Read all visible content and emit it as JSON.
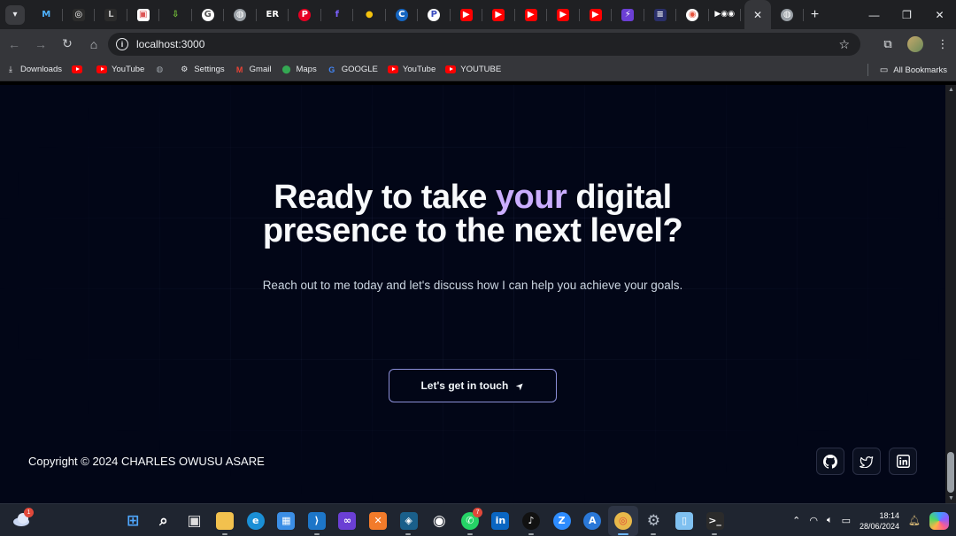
{
  "browser": {
    "tabs": [
      {
        "icon": "v",
        "color": "#3a3b3f",
        "name": "tab-list-icon"
      },
      {
        "icon": "M",
        "color": "#1f2023",
        "text_color": "#4fb3ff",
        "name": "m-icon"
      },
      {
        "icon": "◎",
        "color": "#2b2b2b",
        "name": "openai-icon"
      },
      {
        "icon": "L",
        "color": "#2b2b2b",
        "text_color": "#bbb",
        "name": "l-icon"
      },
      {
        "icon": "▣",
        "color": "#ffffff",
        "text_color": "#d55",
        "name": "app-icon"
      },
      {
        "icon": "⇩",
        "color": "#1f2023",
        "text_color": "#7ccf3a",
        "name": "download-icon"
      },
      {
        "icon": "G",
        "color": "#ffffff",
        "text_color": "#555",
        "name": "g-icon"
      },
      {
        "icon": "◍",
        "color": "#9aa0a6",
        "name": "globe-icon"
      },
      {
        "icon": "ER",
        "color": "#1f2023",
        "text_color": "#fff",
        "name": "er-icon"
      },
      {
        "icon": "P",
        "color": "#e60023",
        "name": "pinterest-icon"
      },
      {
        "icon": "f",
        "color": "#1f2023",
        "text_color": "#7b61ff",
        "name": "f-icon"
      },
      {
        "icon": "●",
        "color": "#1f2023",
        "text_color": "#f4c20d",
        "name": "bulb-icon"
      },
      {
        "icon": "C",
        "color": "#1565c0",
        "name": "c-icon"
      },
      {
        "icon": "P",
        "color": "#ffffff",
        "text_color": "#3b4cc0",
        "name": "p-icon"
      },
      {
        "icon": "▶",
        "color": "#ff0000",
        "name": "youtube-icon"
      },
      {
        "icon": "▶",
        "color": "#ff0000",
        "name": "youtube-icon"
      },
      {
        "icon": "▶",
        "color": "#ff0000",
        "name": "youtube-icon"
      },
      {
        "icon": "▶",
        "color": "#ff0000",
        "name": "youtube-icon"
      },
      {
        "icon": "▶",
        "color": "#ff0000",
        "name": "youtube-icon"
      },
      {
        "icon": "⚡",
        "color": "#6b3fd4",
        "name": "bolt-icon"
      },
      {
        "icon": "≡",
        "color": "#2a2f6a",
        "name": "menu-app-icon"
      },
      {
        "icon": "◉",
        "color": "#ffffff",
        "text_color": "#e5533d",
        "name": "circle-icon"
      },
      {
        "icon": "▶◉◉",
        "color": "#1f2023",
        "text_color": "#fff",
        "name": "grouped-icons"
      }
    ],
    "active_tab_close": "✕",
    "new_tab": "+",
    "window_controls": {
      "minimize": "—",
      "restore": "❐",
      "close": "✕"
    },
    "nav": {
      "back": "←",
      "forward": "→",
      "reload": "↻",
      "home": "⌂"
    },
    "address": "localhost:3000",
    "bookmarks": [
      {
        "label": "Downloads",
        "icon": "download"
      },
      {
        "label": "",
        "icon": "youtube"
      },
      {
        "label": "YouTube",
        "icon": "youtube"
      },
      {
        "label": "",
        "icon": "globe"
      },
      {
        "label": "Settings",
        "icon": "gear"
      },
      {
        "label": "Gmail",
        "icon": "gmail"
      },
      {
        "label": "Maps",
        "icon": "maps"
      },
      {
        "label": "GOOGLE",
        "icon": "google"
      },
      {
        "label": "YouTube",
        "icon": "youtube"
      },
      {
        "label": "YOUTUBE",
        "icon": "youtube"
      }
    ],
    "all_bookmarks": "All Bookmarks"
  },
  "page": {
    "headline_part1": "Ready to take ",
    "headline_accent": "your",
    "headline_part2": " digital presence to the next level?",
    "subtitle": "Reach out to me today and let's discuss how I can help you achieve your goals.",
    "cta_label": "Let's get in touch",
    "copyright": "Copyright © 2024 CHARLES OWUSU ASARE",
    "socials": [
      "github",
      "twitter",
      "linkedin"
    ],
    "accent_color": "#cbaeff",
    "background_color": "#020617"
  },
  "taskbar": {
    "weather_badge": "1",
    "whatsapp_badge": "7",
    "time": "18:14",
    "date": "28/06/2024"
  }
}
